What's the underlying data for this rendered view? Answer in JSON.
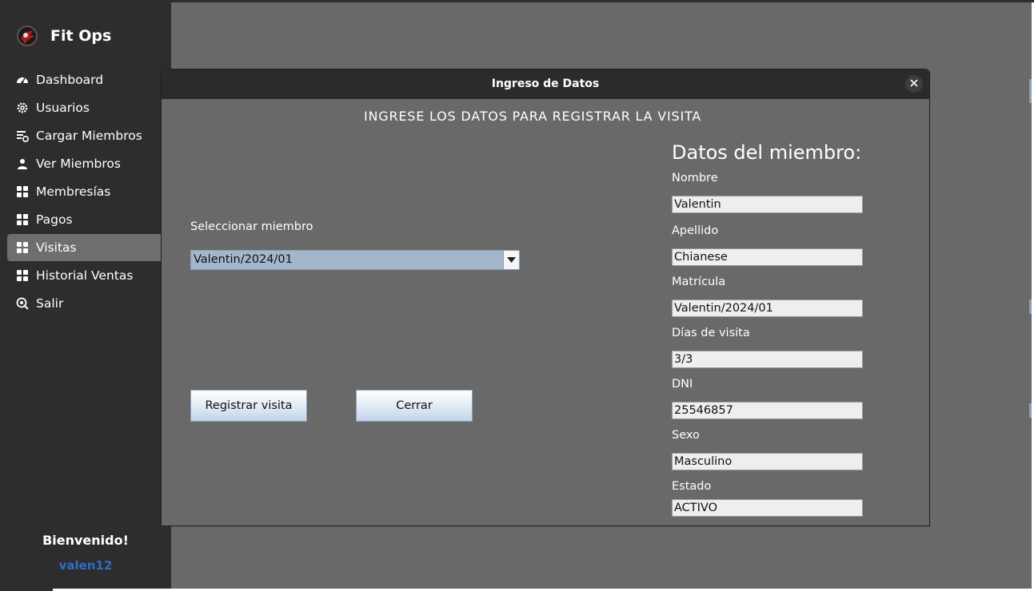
{
  "app": {
    "name": "Fit Ops",
    "nav": [
      {
        "label": "Dashboard",
        "icon": "dashboard-gauge-icon"
      },
      {
        "label": "Usuarios",
        "icon": "gear-icon"
      },
      {
        "label": "Cargar Miembros",
        "icon": "list-add-icon"
      },
      {
        "label": "Ver Miembros",
        "icon": "person-icon"
      },
      {
        "label": "Membresías",
        "icon": "grid-icon"
      },
      {
        "label": "Pagos",
        "icon": "grid-icon"
      },
      {
        "label": "Visitas",
        "icon": "grid-icon",
        "active": true
      },
      {
        "label": "Historial Ventas",
        "icon": "grid-icon"
      },
      {
        "label": "Salir",
        "icon": "logout-icon"
      }
    ],
    "welcome": "Bienvenido!",
    "username": "valen12",
    "accent_color": "#2f6cc9"
  },
  "dialog": {
    "title": "Ingreso de Datos",
    "heading": "INGRESE LOS DATOS PARA REGISTRAR LA VISITA",
    "select_label": "Seleccionar miembro",
    "select_value": "Valentin/2024/01",
    "register_button": "Registrar visita",
    "close_button": "Cerrar",
    "member": {
      "title": "Datos del miembro:",
      "fields": [
        {
          "label": "Nombre",
          "value": "Valentin"
        },
        {
          "label": "Apellido",
          "value": "Chianese"
        },
        {
          "label": "Matrícula",
          "value": "Valentin/2024/01"
        },
        {
          "label": "Días de visita",
          "value": "3/3"
        },
        {
          "label": "DNI",
          "value": "25546857"
        },
        {
          "label": "Sexo",
          "value": "Masculino"
        },
        {
          "label": "Estado",
          "value": "ACTIVO"
        }
      ]
    }
  }
}
